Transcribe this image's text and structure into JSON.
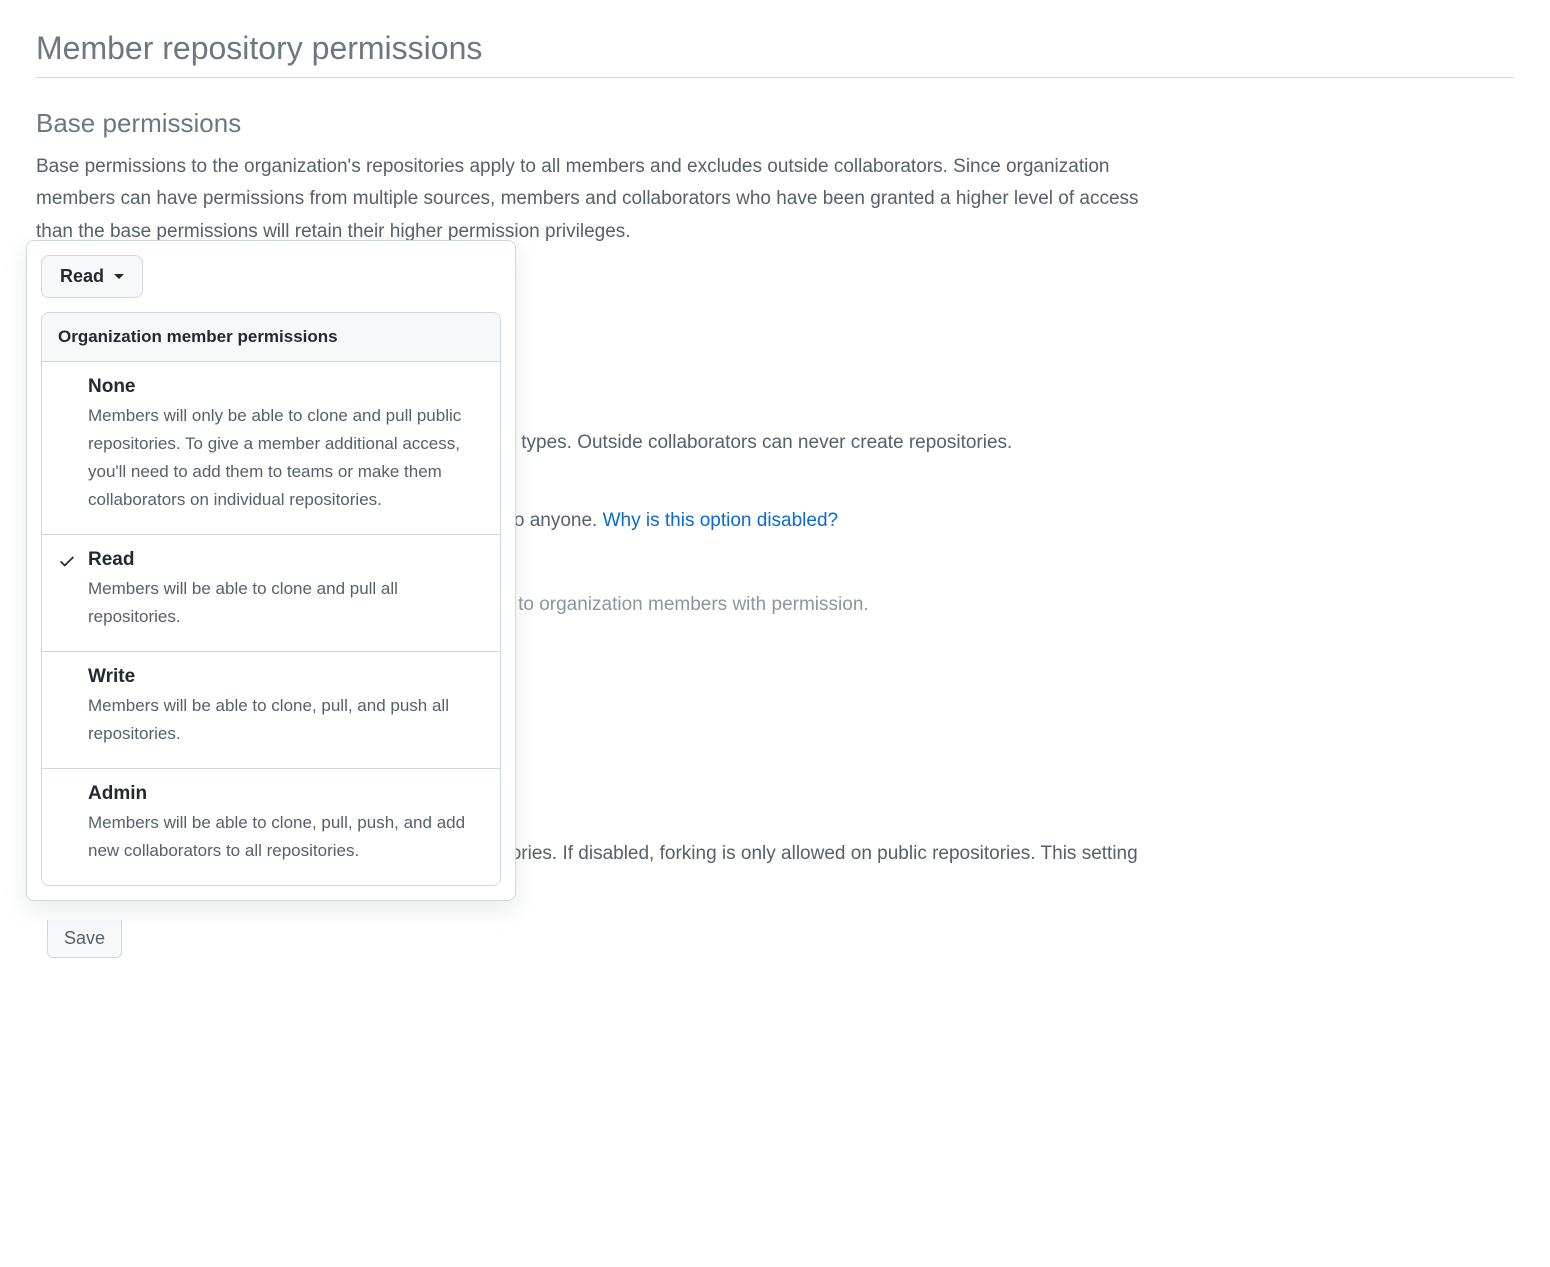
{
  "page": {
    "title": "Member repository permissions"
  },
  "base_permissions": {
    "heading": "Base permissions",
    "description": "Base permissions to the organization's repositories apply to all members and excludes outside collaborators. Since organization members can have permissions from multiple sources, members and collaborators who have been granted a higher level of access than the base permissions will retain their higher permission privileges.",
    "dropdown_button_label": "Read",
    "dropdown_header": "Organization member permissions",
    "options": [
      {
        "title": "None",
        "description": "Members will only be able to clone and pull public repositories. To give a member additional access, you'll need to add them to teams or make them collaborators on individual repositories.",
        "selected": false
      },
      {
        "title": "Read",
        "description": "Members will be able to clone and pull all repositories.",
        "selected": true
      },
      {
        "title": "Write",
        "description": "Members will be able to clone, pull, and push all repositories.",
        "selected": false
      },
      {
        "title": "Admin",
        "description": "Members will be able to clone, pull, push, and add new collaborators to all repositories.",
        "selected": false
      }
    ]
  },
  "background": {
    "repo_types_fragment": "ository types. Outside collaborators can never create repositories.",
    "visible_anyone_fragment": "isible to anyone. ",
    "disabled_link": "Why is this option disabled?",
    "visible_members_fragment": "visible to organization members with permission.",
    "forking_fragment": "epositories. If disabled, forking is only allowed on public repositories. This setting",
    "save_label": "Save"
  }
}
